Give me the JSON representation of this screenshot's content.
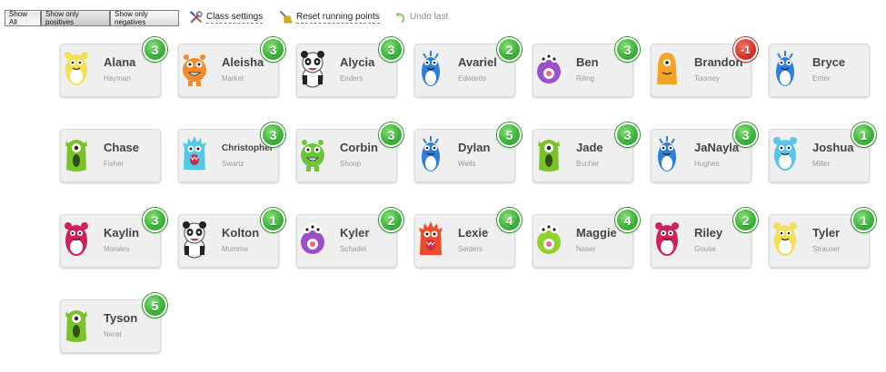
{
  "filters": {
    "show_all": "Show All",
    "show_positives": "Show only positives",
    "show_negatives": "Show only negatives"
  },
  "actions": {
    "class_settings": "Class settings",
    "reset_points": "Reset running points",
    "undo_last": "Undo last"
  },
  "students": [
    {
      "first": "Alana",
      "last": "Hayman",
      "points": "3",
      "sign": "pos",
      "monster": {
        "color": "#f4df5a",
        "type": "bear"
      }
    },
    {
      "first": "Aleisha",
      "last": "Markel",
      "points": "3",
      "sign": "pos",
      "monster": {
        "color": "#f08a2a",
        "type": "round"
      }
    },
    {
      "first": "Alycia",
      "last": "Enders",
      "points": "3",
      "sign": "pos",
      "monster": {
        "color": "#222222",
        "type": "panda"
      }
    },
    {
      "first": "Avariel",
      "last": "Edwards",
      "points": "2",
      "sign": "pos",
      "monster": {
        "color": "#2f7fd8",
        "type": "tall"
      }
    },
    {
      "first": "Ben",
      "last": "Riling",
      "points": "3",
      "sign": "pos",
      "monster": {
        "color": "#9b4fc8",
        "type": "eyes"
      }
    },
    {
      "first": "Brandon",
      "last": "Toomey",
      "points": "-1",
      "sign": "neg",
      "monster": {
        "color": "#f3a325",
        "type": "blob"
      }
    },
    {
      "first": "Bryce",
      "last": "Ertter",
      "points": "",
      "sign": "none",
      "monster": {
        "color": "#2f7fd8",
        "type": "tall"
      }
    },
    {
      "first": "Chase",
      "last": "Fisher",
      "points": "",
      "sign": "none",
      "monster": {
        "color": "#79c22a",
        "type": "cyclops"
      }
    },
    {
      "first": "Christopher",
      "last": "Swartz",
      "points": "3",
      "sign": "pos",
      "monster": {
        "color": "#4fcbe8",
        "type": "spiky"
      }
    },
    {
      "first": "Corbin",
      "last": "Shoop",
      "points": "3",
      "sign": "pos",
      "monster": {
        "color": "#6cc43a",
        "type": "round"
      }
    },
    {
      "first": "Dylan",
      "last": "Wells",
      "points": "5",
      "sign": "pos",
      "monster": {
        "color": "#2f7fd8",
        "type": "tall"
      }
    },
    {
      "first": "Jade",
      "last": "Bucher",
      "points": "3",
      "sign": "pos",
      "monster": {
        "color": "#79c22a",
        "type": "cyclops"
      }
    },
    {
      "first": "JaNayla",
      "last": "Hughes",
      "points": "3",
      "sign": "pos",
      "monster": {
        "color": "#2f7fd8",
        "type": "tall"
      }
    },
    {
      "first": "Joshua",
      "last": "Miller",
      "points": "1",
      "sign": "pos",
      "monster": {
        "color": "#5bc4ea",
        "type": "bear"
      }
    },
    {
      "first": "Kaylin",
      "last": "Morales",
      "points": "3",
      "sign": "pos",
      "monster": {
        "color": "#d0215a",
        "type": "bear"
      }
    },
    {
      "first": "Kolton",
      "last": "Mumma",
      "points": "1",
      "sign": "pos",
      "monster": {
        "color": "#222222",
        "type": "panda"
      }
    },
    {
      "first": "Kyler",
      "last": "Schadel",
      "points": "2",
      "sign": "pos",
      "monster": {
        "color": "#9b4fc8",
        "type": "eyes"
      }
    },
    {
      "first": "Lexie",
      "last": "Seiders",
      "points": "4",
      "sign": "pos",
      "monster": {
        "color": "#ef4a2a",
        "type": "spiky"
      }
    },
    {
      "first": "Maggie",
      "last": "Naser",
      "points": "4",
      "sign": "pos",
      "monster": {
        "color": "#8fd42a",
        "type": "eyes"
      }
    },
    {
      "first": "Riley",
      "last": "Gouse",
      "points": "2",
      "sign": "pos",
      "monster": {
        "color": "#d0215a",
        "type": "bear"
      }
    },
    {
      "first": "Tyler",
      "last": "Strauser",
      "points": "1",
      "sign": "pos",
      "monster": {
        "color": "#f4df5a",
        "type": "bear"
      }
    },
    {
      "first": "Tyson",
      "last": "Nerat",
      "points": "5",
      "sign": "pos",
      "monster": {
        "color": "#79c22a",
        "type": "cyclops"
      }
    }
  ]
}
